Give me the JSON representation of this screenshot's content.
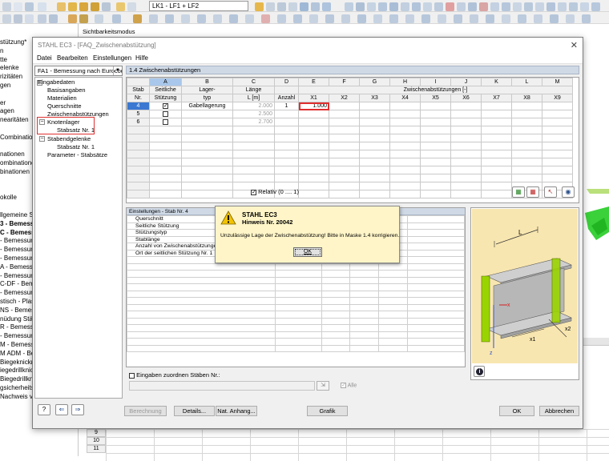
{
  "toolbar": {
    "load_combo": "LK1 - LF1 + LF2"
  },
  "background": {
    "side_tab": "Sichtbarkeitsmodus",
    "nav_items": [
      "stützung*",
      "n",
      "tte",
      "elenke",
      "rizitäten",
      "gen",
      "",
      "er",
      "agen",
      "nearitäten",
      "",
      "Combination",
      "",
      "nationen",
      "ombinationen",
      "binationen",
      "",
      "",
      "okolle",
      "",
      "llgemeine Sp",
      "3 - Bemessung",
      "C - Bemessun",
      "- Bemessung",
      "- Bemessun",
      "- Bemessun",
      "A - Bemessun",
      "- Bemessung",
      "C-DF - Bemes",
      "- Bemessun",
      "stisch - Plast",
      "NS - Bemessu",
      "nüdung Stäb",
      "R - Bemessun",
      "- Bemessun",
      "M - Bemessun",
      "M ADM - Bem",
      "Biegeknickna",
      "iegedrillknick",
      "Biegedrillknicknachweis",
      "gsicherheitsnachweis nac",
      "Nachweis von grenz c/t"
    ],
    "grid_rows": [
      "9",
      "10",
      "11"
    ]
  },
  "dialog": {
    "title": "STAHL EC3 - [FAQ_Zwischenabstützung]",
    "menu": [
      "Datei",
      "Bearbeiten",
      "Einstellungen",
      "Hilfe"
    ],
    "case_combo": "FA1 - Bemessung nach Eurocod",
    "tree": {
      "root": "Eingabedaten",
      "items": [
        "Basisangaben",
        "Materialien",
        "Querschnitte",
        "Zwischenabstützungen"
      ],
      "knotenlager": "Knotenlager",
      "knotenlager_child": "Stabsatz Nr. 1",
      "stabendgelenke": "Stabendgelenke",
      "stabendgelenke_child": "Stabsatz Nr. 1",
      "params": "Parameter - Stabsätze"
    },
    "panel_title": "1.4 Zwischenabstützungen",
    "table": {
      "col_letters": [
        "A",
        "B",
        "C",
        "D",
        "E",
        "F",
        "G",
        "H",
        "I",
        "J",
        "K",
        "L",
        "M"
      ],
      "h1": {
        "stab": "Stab",
        "a": "Seitliche",
        "b": "Lager-",
        "c": "Länge",
        "zw": "Zwischenabstützungen [-]"
      },
      "h2": {
        "stab": "Nr.",
        "a": "Stützung",
        "b": "typ",
        "c": "L [m]",
        "d": "Anzahl",
        "x": [
          "X1",
          "X2",
          "X3",
          "X4",
          "X5",
          "X6",
          "X7",
          "X8",
          "X9"
        ]
      },
      "rows": [
        {
          "nr": "4",
          "checked": true,
          "lagertyp": "Gabellagerung",
          "laenge": "2.000",
          "anzahl": "1",
          "x1": "1.000"
        },
        {
          "nr": "5",
          "checked": false,
          "lagertyp": "",
          "laenge": "2.500",
          "anzahl": "",
          "x1": ""
        },
        {
          "nr": "6",
          "checked": false,
          "lagertyp": "",
          "laenge": "2.700",
          "anzahl": "",
          "x1": ""
        }
      ]
    },
    "relative_label": "Relativ (0 .... 1)",
    "settings": {
      "title": "Einstellungen - Stab Nr. 4",
      "rows": [
        "Querschnitt",
        "Seitliche Stützung",
        "Stützungstyp",
        "Stablänge",
        "Anzahl von Zwischenabstützungen",
        "Ort der seitlichen Stützung Nr. 1"
      ]
    },
    "assign_label": "Eingaben zuordnen Stäben Nr.:",
    "alle_label": "Alle",
    "buttons": {
      "berechnung": "Berechnung",
      "details": "Details...",
      "nat_anhang": "Nat. Anhang...",
      "grafik": "Grafik",
      "ok": "OK",
      "abbrechen": "Abbrechen"
    },
    "preview_labels": {
      "L": "L",
      "x": "x",
      "z": "z",
      "x1": "x1",
      "x2": "x2"
    }
  },
  "message": {
    "title": "STAHL EC3",
    "subtitle": "Hinweis Nr. 20042",
    "text": "Unzulässige Lage der Zwischenabstützung! Bitte in Maske 1.4 korrigieren.",
    "ok": "OK"
  },
  "colors": {
    "selected_row": "#3a78d2",
    "column_a_header": "#a9c7ea",
    "highlight": "#e03030",
    "message_bg": "#fff5c8",
    "preview_bg": "#f8e6b0",
    "support_green": "#9ad400"
  }
}
